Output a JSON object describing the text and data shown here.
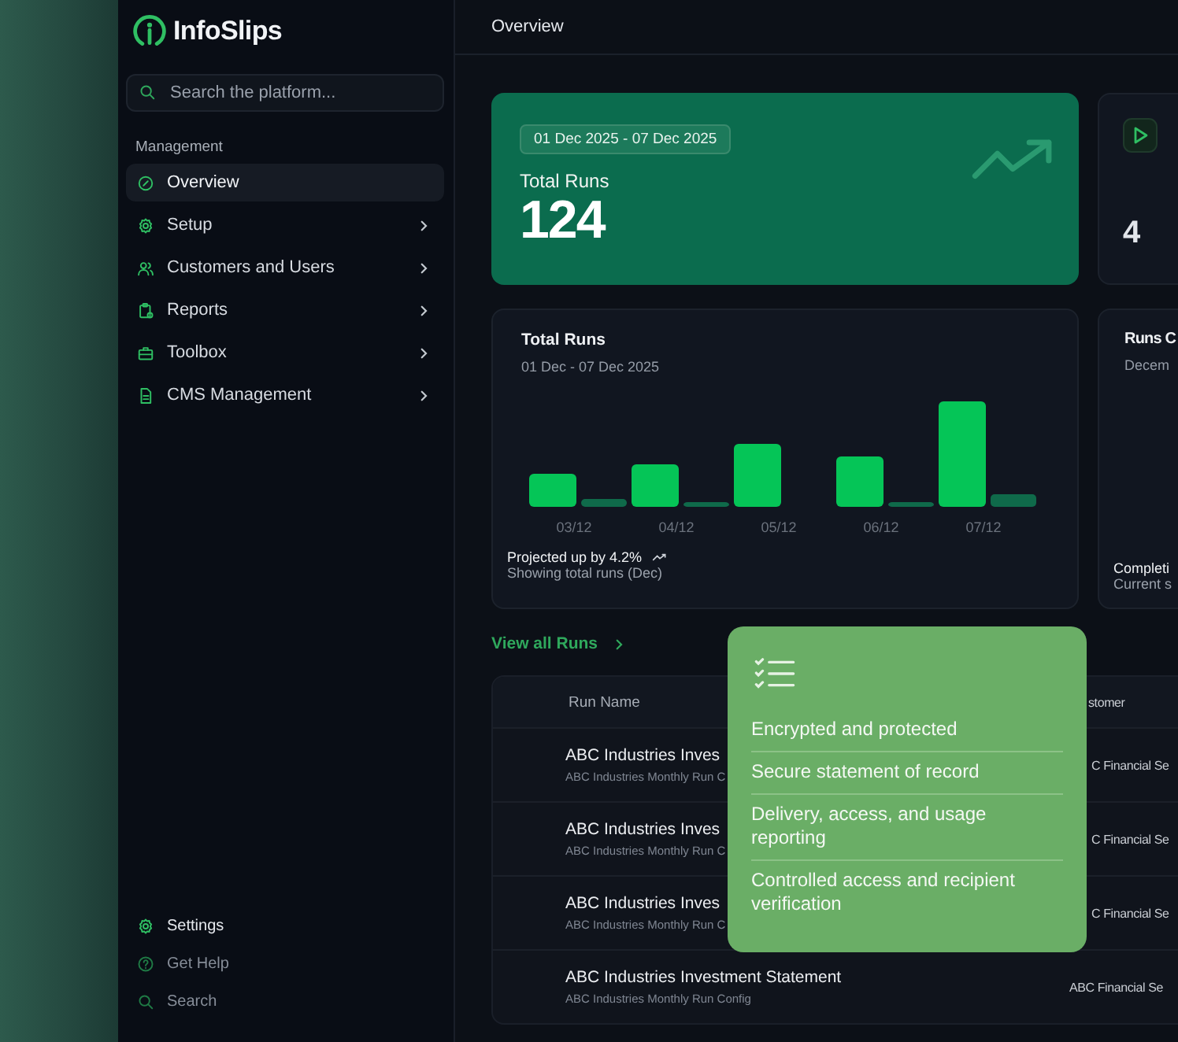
{
  "sidebar": {
    "logo": "InfoSlips",
    "search": {
      "placeholder": "Search the platform..."
    },
    "section": "Management",
    "items": [
      {
        "label": "Overview",
        "kind": "gauge",
        "selected": true,
        "chevron": false
      },
      {
        "label": "Setup",
        "kind": "gear",
        "selected": false,
        "chevron": true
      },
      {
        "label": "Customers and Users",
        "kind": "users",
        "selected": false,
        "chevron": true
      },
      {
        "label": "Reports",
        "kind": "clipboard",
        "selected": false,
        "chevron": true
      },
      {
        "label": "Toolbox",
        "kind": "toolbox",
        "selected": false,
        "chevron": true
      },
      {
        "label": "CMS Management",
        "kind": "file",
        "selected": false,
        "chevron": true
      }
    ],
    "footer": [
      {
        "label": "Settings",
        "kind": "gear",
        "selected": true
      },
      {
        "label": "Get Help",
        "kind": "help",
        "selected": false
      },
      {
        "label": "Search",
        "kind": "search",
        "selected": false
      }
    ]
  },
  "header": {
    "title": "Overview"
  },
  "kpi": {
    "range": "01 Dec 2025 - 07 Dec 2025",
    "label": "Total Runs",
    "value": "124"
  },
  "kpi_2": {
    "value": "4"
  },
  "chart_card": {
    "title": "Total Runs",
    "subtitle": "01 Dec - 07 Dec 2025",
    "x_labels": [
      "03/12",
      "04/12",
      "05/12",
      "06/12",
      "07/12"
    ],
    "trend": "Projected up by 4.2%",
    "note": "Showing total runs (Dec)"
  },
  "card_2": {
    "title": "Runs C",
    "subtitle": "Decem",
    "footer_title": "Completi",
    "footer_note": "Current s"
  },
  "view_all": "View all Runs",
  "table": {
    "columns": [
      "Run Name",
      "stomer"
    ],
    "rows": [
      {
        "name": "ABC Industries Inves",
        "config": "ABC Industries Monthly Run C",
        "customer": "C Financial Se",
        "covered": true
      },
      {
        "name": "ABC Industries Inves",
        "config": "ABC Industries Monthly Run C",
        "customer": "C Financial Se",
        "covered": true
      },
      {
        "name": "ABC Industries Inves",
        "config": "ABC Industries Monthly Run C",
        "customer": "C Financial Se",
        "covered": true
      },
      {
        "name": "ABC Industries Investment Statement",
        "config": "ABC Industries Monthly Run Config",
        "customer": "ABC Financial Se",
        "covered": false
      }
    ]
  },
  "popup": {
    "items": [
      "Encrypted and protected",
      "Secure statement of record",
      "Delivery, access, and usage reporting",
      "Controlled access and recipient verification"
    ]
  }
}
